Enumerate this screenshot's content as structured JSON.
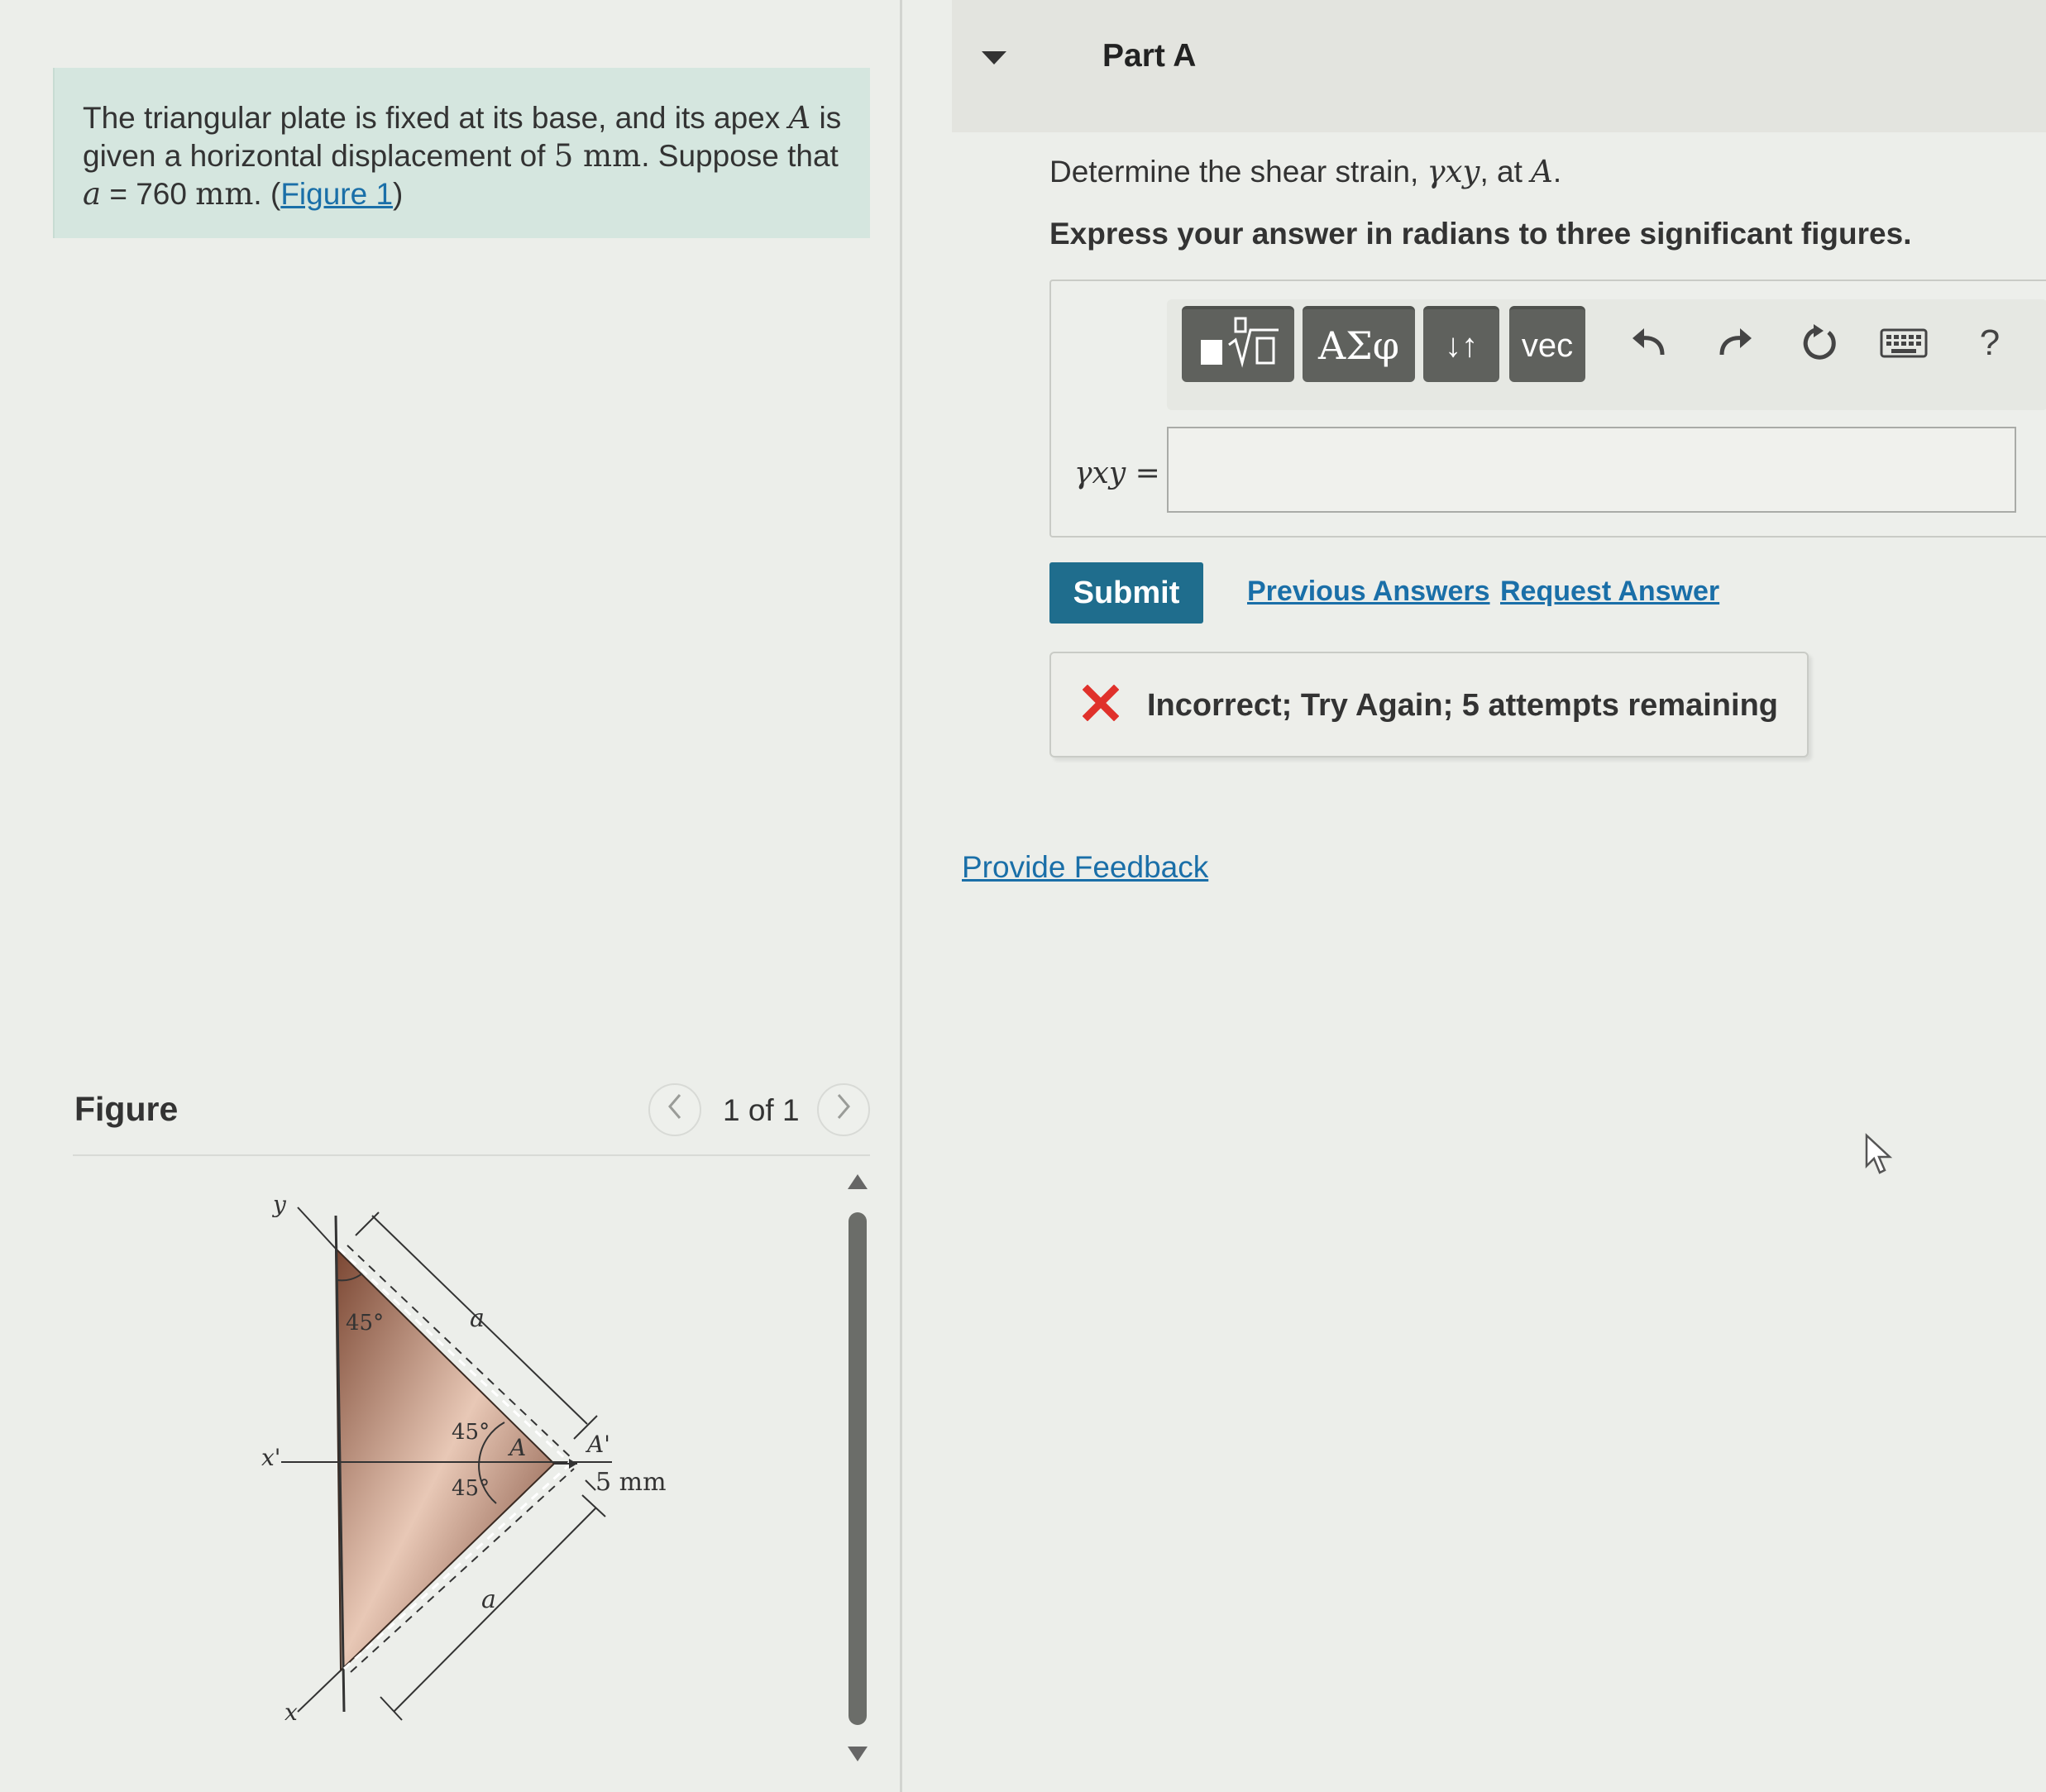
{
  "problem": {
    "text_1": "The triangular plate is fixed at its base, and its apex ",
    "apex_symbol": "A",
    "text_2": " is given a horizontal displacement of ",
    "displacement": "5 mm",
    "text_3": ". Suppose that ",
    "a_symbol": "a",
    "equals": " = 760 ",
    "a_unit": "mm",
    "text_4": ". (",
    "figure_link": "Figure 1",
    "text_5": ")"
  },
  "figure": {
    "title": "Figure",
    "pager_text": "1 of 1",
    "prev_icon": "chevron-left-icon",
    "next_icon": "chevron-right-icon",
    "labels": {
      "y": "y",
      "x": "x",
      "x_prime": "x'",
      "a_top": "a",
      "a_bottom": "a",
      "angle_top": "45°",
      "angle_mid_top": "45°",
      "angle_mid_bottom": "45°",
      "apex": "A",
      "apex_prime": "A'",
      "displacement": "5 mm"
    },
    "colors": {
      "plate_dark": "#7a4632",
      "plate_light": "#e8c8b6"
    }
  },
  "part": {
    "title": "Part A",
    "question_prefix": "Determine the shear strain, ",
    "question_symbol": "γxy",
    "question_mid": ", at ",
    "question_point": "A",
    "question_suffix": ".",
    "instructions": "Express your answer in radians to three significant figures.",
    "answer_label": "γxy =",
    "answer_value": "",
    "toolbar": {
      "templates_icon": "templates-icon",
      "greek_label": "ΑΣφ",
      "sort_label": "↓↑",
      "vec_label": "vec",
      "undo_icon": "undo-icon",
      "redo_icon": "redo-icon",
      "reset_icon": "reset-icon",
      "keyboard_icon": "keyboard-icon",
      "help_label": "?"
    },
    "submit_label": "Submit",
    "previous_answers": "Previous Answers",
    "request_answer": "Request Answer",
    "feedback": "Incorrect; Try Again; 5 attempts remaining",
    "provide_feedback": "Provide Feedback"
  },
  "colors": {
    "accent": "#1f6d8d",
    "link": "#1a6fa8",
    "error": "#e0312b",
    "problem_bg": "#d5e6df"
  }
}
